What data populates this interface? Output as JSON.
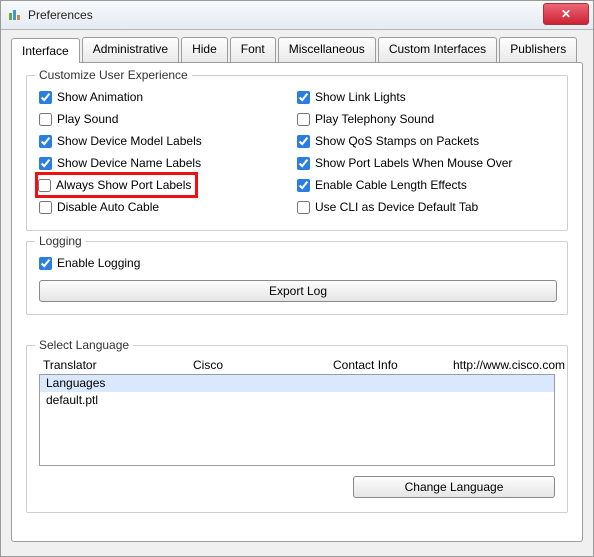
{
  "window": {
    "title": "Preferences"
  },
  "tabs": {
    "interface": "Interface",
    "administrative": "Administrative",
    "hide": "Hide",
    "font": "Font",
    "misc": "Miscellaneous",
    "custom": "Custom Interfaces",
    "publishers": "Publishers"
  },
  "groups": {
    "ux": "Customize User Experience",
    "logging": "Logging",
    "lang": "Select Language"
  },
  "ux": {
    "show_animation": "Show Animation",
    "play_sound": "Play Sound",
    "show_device_model": "Show Device Model Labels",
    "show_device_name": "Show Device Name Labels",
    "always_show_port": "Always Show Port Labels",
    "disable_auto_cable": "Disable Auto Cable",
    "show_link_lights": "Show Link Lights",
    "play_telephony": "Play Telephony Sound",
    "show_qos": "Show QoS Stamps on Packets",
    "show_port_hover": "Show Port Labels When Mouse Over",
    "enable_cable_len": "Enable Cable Length Effects",
    "use_cli_default": "Use CLI as Device Default Tab"
  },
  "logging": {
    "enable": "Enable Logging",
    "export_btn": "Export Log"
  },
  "lang": {
    "cols": {
      "translator": "Translator",
      "cisco": "Cisco",
      "contact": "Contact Info",
      "url": "http://www.cisco.com"
    },
    "row_languages": "Languages",
    "row_default": "default.ptl",
    "change_btn": "Change Language"
  }
}
